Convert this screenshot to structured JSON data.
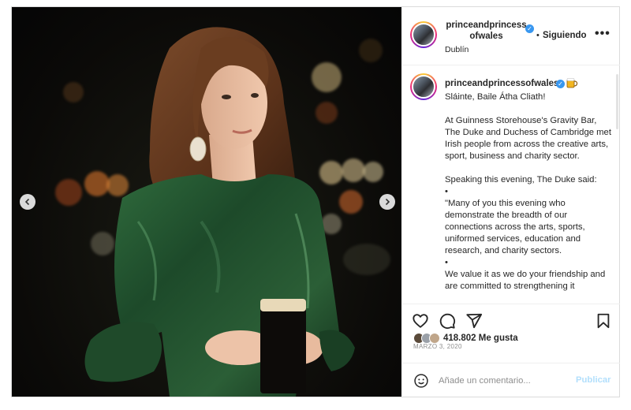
{
  "post": {
    "username": "princeandprincessofwales",
    "username_line1": "princeandprincess",
    "username_line2": "ofwales",
    "follow_status": "Siguiendo",
    "separator": "•",
    "more": "•••",
    "location": "Dublín",
    "caption_emoji": "beer-mug-icon",
    "caption": [
      "Sláinte, Baile Átha Cliath!",
      "",
      "At Guinness Storehouse's Gravity Bar, The Duke and Duchess of Cambridge met Irish people from across the creative arts, sport, business and charity sector.",
      "",
      "Speaking this evening, The Duke said:",
      "•",
      "\"Many of you this evening who demonstrate the breadth of our connections across the arts, sports, uniformed services, education and research, and charity sectors.",
      "•",
      "We value it as we do your friendship and are committed to strengthening it"
    ],
    "likes": "418.802 Me gusta",
    "date": "MARZO 3, 2020",
    "comment_placeholder": "Añade un comentario...",
    "publish": "Publicar"
  },
  "icons": {
    "prev": "chevron-left-icon",
    "next": "chevron-right-icon",
    "like": "heart-icon",
    "comment": "comment-bubble-icon",
    "share": "paper-plane-icon",
    "save": "bookmark-icon",
    "emoji": "smiley-icon",
    "verified": "verified-badge-icon"
  },
  "colors": {
    "verified": "#3897f0",
    "publish_disabled": "#b2dffc",
    "meta_gray": "#8e8e8e"
  }
}
